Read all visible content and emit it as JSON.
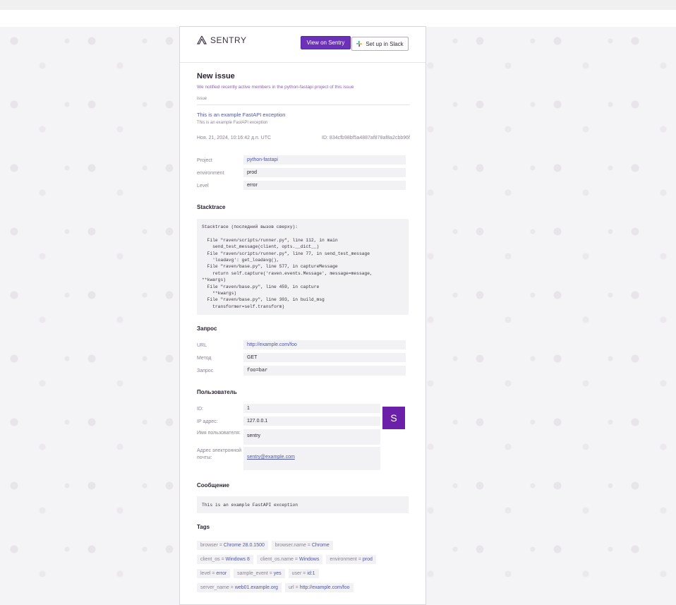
{
  "header": {
    "logo_text": "SENTRY",
    "view_button": "View on Sentry",
    "slack_button": "Set up in Slack"
  },
  "issue": {
    "heading": "New issue",
    "notified": "We notified recently active members in the python-fastapi project of this issue",
    "type": "issue",
    "title": "This is an example FastAPI exception",
    "subtitle": "This is an example FastAPI exception",
    "date": "Ноя. 21, 2024, 10:16:42 д.п. UTC",
    "id": "ID: 834cfb98bf5a4887af878af8a2cbb96f"
  },
  "details": [
    {
      "key": "Project",
      "value": "python-fastapi",
      "link": true
    },
    {
      "key": "environment",
      "value": "prod",
      "link": false
    },
    {
      "key": "Level",
      "value": "error",
      "link": false
    }
  ],
  "stacktrace": {
    "heading": "Stacktrace",
    "text": "Stacktrace (последний вызов сверху):\n\n  File \"raven/scripts/runner.py\", line 112, in main\n    send_test_message(client, opts.__dict__)\n  File \"raven/scripts/runner.py\", line 77, in send_test_message\n    'loadavg': get_loadavg(),\n  File \"raven/base.py\", line 577, in captureMessage\n    return self.capture('raven.events.Message', message=message,\n**kwargs)\n  File \"raven/base.py\", line 459, in capture\n    **kwargs)\n  File \"raven/base.py\", line 303, in build_msg\n    transformer=self.transform)"
  },
  "request": {
    "heading": "Запрос",
    "rows": [
      {
        "key": "URL",
        "value": "http://example.com/foo",
        "link": true
      },
      {
        "key": "Метод",
        "value": "GET",
        "link": false
      },
      {
        "key": "Запрос",
        "value": "foo=bar",
        "link": false
      }
    ]
  },
  "user": {
    "heading": "Пользователь",
    "avatar_letter": "S",
    "rows": [
      {
        "key": "ID:",
        "value": "1"
      },
      {
        "key": "IP адрес:",
        "value": "127.0.0.1"
      },
      {
        "key": "Имя пользователя:",
        "value": "sentry"
      },
      {
        "key": "Адрес электронной почты:",
        "value": "sentry@example.com"
      }
    ]
  },
  "message": {
    "heading": "Сообщение",
    "text": "This is an example FastAPI exception"
  },
  "tags": {
    "heading": "Tags",
    "rows": [
      [
        {
          "k": "browser",
          "v": "Chrome 28.0.1500"
        },
        {
          "k": "browser.name",
          "v": "Chrome"
        }
      ],
      [
        {
          "k": "client_os",
          "v": "Windows 8"
        },
        {
          "k": "client_os.name",
          "v": "Windows"
        },
        {
          "k": "environment",
          "v": "prod"
        }
      ],
      [
        {
          "k": "level",
          "v": "error"
        },
        {
          "k": "sample_event",
          "v": "yes"
        },
        {
          "k": "user",
          "v": "id:1"
        }
      ],
      [
        {
          "k": "server_name",
          "v": "web01.example.org"
        },
        {
          "k": "url",
          "v": "http://example.com/foo"
        }
      ]
    ]
  },
  "colors": {
    "accent": "#6c31b9",
    "link": "#4e57a8",
    "avatar": "#6c1fa8"
  }
}
